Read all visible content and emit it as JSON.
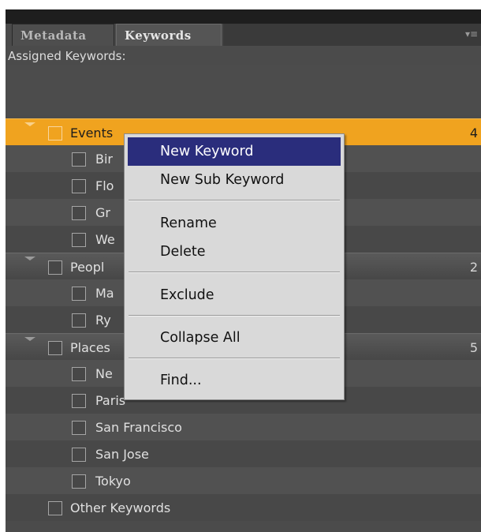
{
  "tabs": [
    {
      "label": "Metadata",
      "active": false
    },
    {
      "label": "Keywords",
      "active": true
    }
  ],
  "panel_menu_icon": "panel-menu-icon",
  "assigned_keywords": {
    "label": "Assigned Keywords:",
    "value": ""
  },
  "keywords": [
    {
      "label": "Events",
      "level": 0,
      "count": "4",
      "selected": true
    },
    {
      "label": "Birthday",
      "visible_text": "Bir",
      "level": 1
    },
    {
      "label": "Florida",
      "visible_text": "Flo",
      "level": 1
    },
    {
      "label": "Graduation",
      "visible_text": "Gr",
      "level": 1
    },
    {
      "label": "Wedding",
      "visible_text": "We",
      "level": 1
    },
    {
      "label": "People",
      "visible_text": "Peopl",
      "level": 0,
      "count": "2"
    },
    {
      "label": "Ma",
      "visible_text": "Ma",
      "level": 1
    },
    {
      "label": "Ry",
      "visible_text": "Ry",
      "level": 1
    },
    {
      "label": "Places",
      "visible_text": "Places",
      "level": 0,
      "count": "5"
    },
    {
      "label": "Ne",
      "visible_text": "Ne",
      "level": 1
    },
    {
      "label": "Paris",
      "level": 1
    },
    {
      "label": "San Francisco",
      "level": 1
    },
    {
      "label": "San Jose",
      "level": 1
    },
    {
      "label": "Tokyo",
      "level": 1
    },
    {
      "label": "Other Keywords",
      "level": 0
    }
  ],
  "context_menu": {
    "items": [
      {
        "label": "New Keyword",
        "highlighted": true
      },
      {
        "label": "New Sub Keyword"
      },
      {
        "label": "Rename"
      },
      {
        "label": "Delete"
      },
      {
        "label": "Exclude"
      },
      {
        "label": "Collapse All"
      },
      {
        "label": "Find..."
      }
    ]
  },
  "colors": {
    "selected_row": "#f0a31f",
    "menu_highlight": "#2a2d7c",
    "panel_bg": "#4b4b4b"
  }
}
